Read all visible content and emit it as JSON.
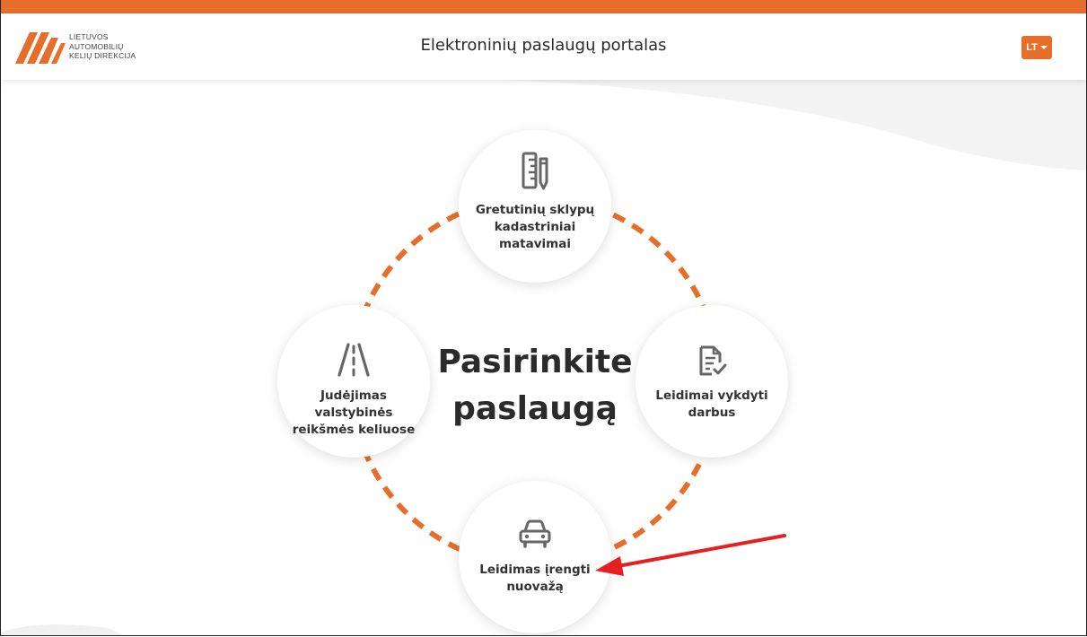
{
  "header": {
    "logo_lines": [
      "LIETUVOS",
      "AUTOMOBILIŲ",
      "KELIŲ DIREKCIJA"
    ],
    "title": "Elektroninių paslaugų portalas",
    "language": "LT"
  },
  "main": {
    "heading_line1": "Pasirinkite",
    "heading_line2": "paslaugą",
    "services": [
      {
        "label_lines": [
          "Gretutinių sklypų",
          "kadastriniai",
          "matavimai"
        ],
        "icon": "ruler-pencil-icon"
      },
      {
        "label_lines": [
          "Judėjimas valstybinės",
          "reikšmės keliuose"
        ],
        "icon": "road-icon"
      },
      {
        "label_lines": [
          "Leidimai vykdyti",
          "darbus"
        ],
        "icon": "document-check-icon"
      },
      {
        "label_lines": [
          "Leidimas įrengti",
          "nuovažą"
        ],
        "icon": "car-icon"
      }
    ]
  },
  "colors": {
    "accent": "#e76d2a",
    "annotation_arrow": "#e62020"
  }
}
